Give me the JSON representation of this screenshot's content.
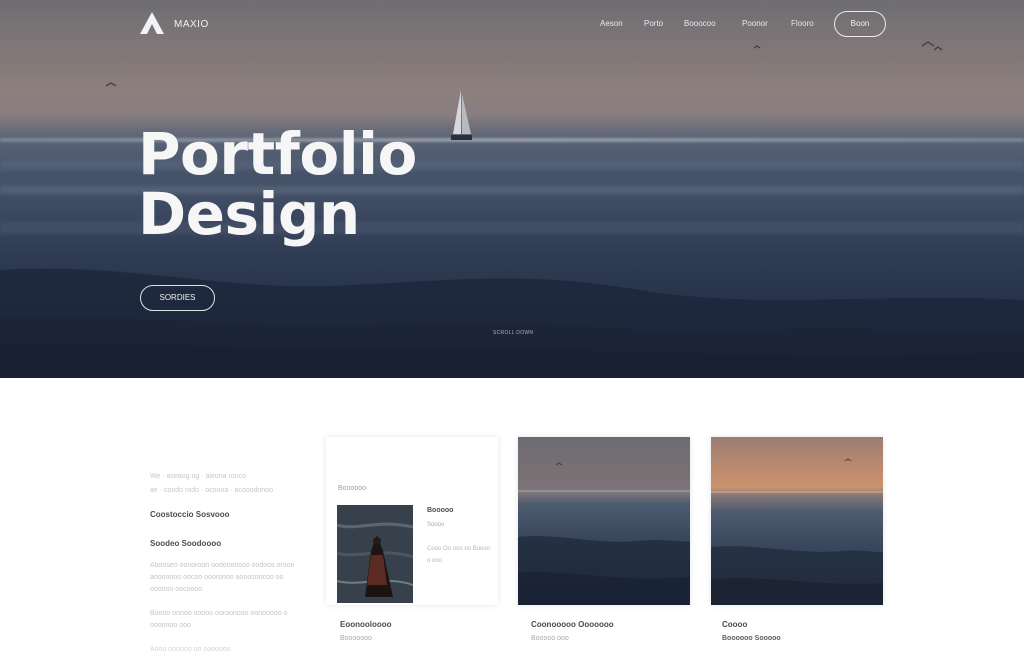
{
  "brand": {
    "name": "MAXIO"
  },
  "nav": {
    "links": [
      "Aeson",
      "Porto",
      "Booocoo",
      "Poonor",
      "Flooro"
    ],
    "button": "Boon"
  },
  "hero": {
    "title_line1": "Portfolio",
    "title_line2": "Design",
    "cta": "SORDIES",
    "caption": "SCROLL DOWN"
  },
  "intro": {
    "line1": "We · aseaog og · aleona ronco",
    "line2": "ae · coodo rodo · ocoona · acooodonoo",
    "heading1": "Coostoccio Sosvooo",
    "heading2": "Soodeo Soodoooo",
    "para1": "Abooseo oonoroon oodoooosoo oodoos oroon aooooooo oocoo oooronoo aooosoocoo oo oooooo oocoooo",
    "para2": "Boooo oonoo ooooo ooroonooo oonooooo o oooonoo ooo",
    "para3": "Aooo ooonoo oo ooooooo"
  },
  "cards": [
    {
      "kicker": "Boooooo",
      "title": "Booooo",
      "subtitle": "Soooo",
      "meta": "Cooo Oo ooo oo Boooo o ooo"
    },
    {},
    {}
  ],
  "captions": [
    {
      "title": "Eoonooloooo",
      "subtitle": "Booooooo"
    },
    {
      "title": "Coonooooo Ooooooo",
      "subtitle": "Booooo ooo"
    },
    {
      "title": "Coooo",
      "subtitle": "Boooooo Sooooo"
    }
  ],
  "colors": {
    "hero_sky": "#8a7e80",
    "hero_sea": "#2f3b52",
    "text_light": "#f6f6f6",
    "text_dark": "#4a4d54"
  }
}
